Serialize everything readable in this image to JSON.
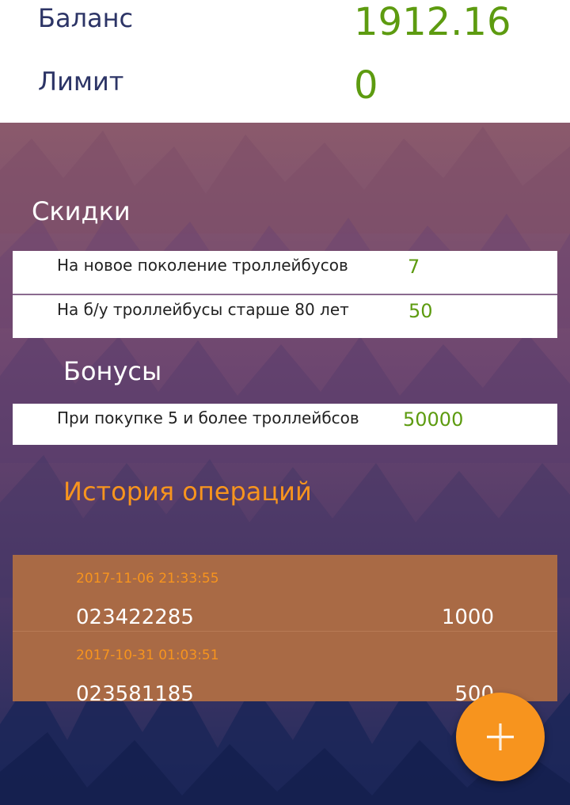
{
  "balance": {
    "label": "Баланс",
    "value": "1912.16"
  },
  "limit": {
    "label": "Лимит",
    "value": "0"
  },
  "discounts": {
    "title": "Скидки",
    "items": [
      {
        "label": "На новое поколение троллейбусов",
        "value": "7"
      },
      {
        "label": "На б/у троллейбусы старше 80 лет",
        "value": "50"
      }
    ]
  },
  "bonuses": {
    "title": "Бонусы",
    "items": [
      {
        "label": "При покупке 5 и более троллейбсов",
        "value": "50000"
      }
    ]
  },
  "history": {
    "title": "История операций",
    "operations": [
      {
        "date": "2017-11-06 21:33:55",
        "number": "023422285",
        "amount": "1000"
      },
      {
        "date": "2017-10-31 01:03:51",
        "number": "023581185",
        "amount": "500"
      }
    ]
  },
  "fab": {
    "icon": "plus-icon"
  },
  "colors": {
    "accent_green": "#5d9b10",
    "accent_orange": "#f7941e",
    "header_text": "#2c3466",
    "history_bg": "#a96a45"
  }
}
